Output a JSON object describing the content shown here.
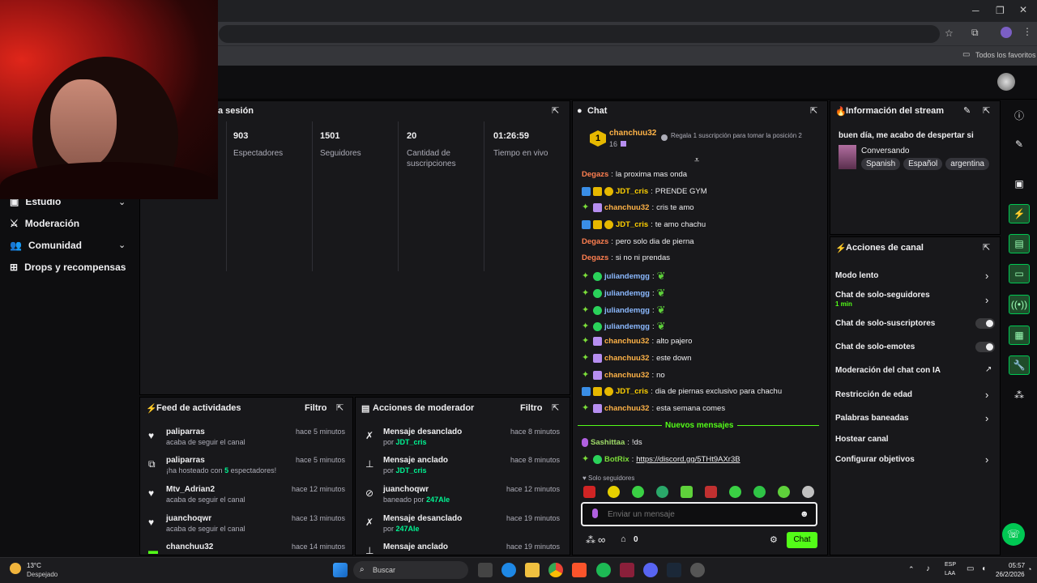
{
  "browser": {
    "bookmarks_label": "Todos los favoritos"
  },
  "nav": {
    "items": [
      {
        "label": "Estudio"
      },
      {
        "label": "Moderación"
      },
      {
        "label": "Comunidad"
      },
      {
        "label": "Drops y recompensas"
      }
    ]
  },
  "session": {
    "title_fragment": "a sesión",
    "stats": [
      {
        "value": "903",
        "label": "Espectadores"
      },
      {
        "value": "1501",
        "label": "Seguidores"
      },
      {
        "value": "20",
        "label": "Cantidad de suscripciones"
      },
      {
        "value": "01:26:59",
        "label": "Tiempo en vivo"
      }
    ]
  },
  "feed": {
    "title": "Feed de actividades",
    "filter": "Filtro",
    "items": [
      {
        "name": "paliparras",
        "sub": "acaba de seguir el canal",
        "time": "hace 5 minutos"
      },
      {
        "name": "paliparras",
        "sub_pre": "¡ha hosteado con ",
        "sub_num": "5",
        "sub_post": " espectadores!",
        "time": "hace 5 minutos"
      },
      {
        "name": "Mtv_Adrian2",
        "sub": "acaba de seguir el canal",
        "time": "hace 12 minutos"
      },
      {
        "name": "juanchoqwr",
        "sub": "acaba de seguir el canal",
        "time": "hace 13 minutos"
      },
      {
        "name": "chanchuu32",
        "time": "hace 14 minutos"
      }
    ]
  },
  "modactions": {
    "title": "Acciones de moderador",
    "filter": "Filtro",
    "items": [
      {
        "title": "Mensaje desanclado",
        "by": "por",
        "user": "JDT_cris",
        "time": "hace 8 minutos"
      },
      {
        "title": "Mensaje anclado",
        "by": "por",
        "user": "JDT_cris",
        "time": "hace 8 minutos"
      },
      {
        "title": "juanchoqwr",
        "by": "baneado por",
        "user": "247Ale",
        "time": "hace 12 minutos"
      },
      {
        "title": "Mensaje desanclado",
        "by": "por",
        "user": "247Ale",
        "time": "hace 19 minutos"
      },
      {
        "title": "Mensaje anclado",
        "time": "hace 19 minutos"
      }
    ]
  },
  "chat": {
    "title": "Chat",
    "pinned": {
      "user": "chanchuu32",
      "count": "16",
      "text": "Regala 1 suscripción para tomar la posición 2",
      "rank": "1"
    },
    "messages": [
      {
        "user": "Degazs",
        "text": "la proxima mas onda"
      },
      {
        "user": "JDT_cris",
        "text": "PRENDE GYM"
      },
      {
        "user": "chanchuu32",
        "text": "cris te amo"
      },
      {
        "user": "JDT_cris",
        "text": "te amo chachu"
      },
      {
        "user": "Degazs",
        "text": "pero solo dia de pierna"
      },
      {
        "user": "Degazs",
        "text": "si no ni prendas"
      },
      {
        "user": "juliandemgg",
        "text": ""
      },
      {
        "user": "juliandemgg",
        "text": ""
      },
      {
        "user": "juliandemgg",
        "text": ""
      },
      {
        "user": "juliandemgg",
        "text": ""
      },
      {
        "user": "chanchuu32",
        "text": "alto pajero"
      },
      {
        "user": "chanchuu32",
        "text": "este down"
      },
      {
        "user": "chanchuu32",
        "text": "no"
      },
      {
        "user": "JDT_cris",
        "text": "dia de piernas exclusivo para chachu"
      },
      {
        "user": "chanchuu32",
        "text": "esta semana comes"
      }
    ],
    "new_messages": "Nuevos mensajes",
    "after": [
      {
        "user": "Sashittaa",
        "text": "!ds"
      },
      {
        "user": "BotRix",
        "text": "https://discord.gg/5THt9AXr3B"
      }
    ],
    "followers_only": "Solo seguidores",
    "input_placeholder": "Enviar un mensaje",
    "points": "0",
    "send_label": "Chat"
  },
  "streaminfo": {
    "title": "Información del stream",
    "stream_title": "buen día, me acabo de despertar si",
    "category": "Conversando",
    "tags": [
      "Spanish",
      "Español",
      "argentina"
    ]
  },
  "channel_actions": {
    "title": "Acciones de canal",
    "items": [
      {
        "label": "Modo lento"
      },
      {
        "label": "Chat de solo-seguidores",
        "sub": "1 min"
      },
      {
        "label": "Chat de solo-suscriptores"
      },
      {
        "label": "Chat de solo-emotes"
      },
      {
        "label": "Moderación del chat con IA"
      },
      {
        "label": "Restricción de edad"
      },
      {
        "label": "Palabras baneadas"
      },
      {
        "label": "Hostear canal"
      },
      {
        "label": "Configurar objetivos"
      }
    ]
  },
  "taskbar": {
    "weather_temp": "13°C",
    "weather_desc": "Despejado",
    "search": "Buscar",
    "lang1": "ESP",
    "lang2": "LAA",
    "time": "05:57",
    "date": "26/2/2026"
  },
  "colors": {
    "accent": "#53fc18",
    "panel": "#18181b",
    "bg": "#0e0e10"
  }
}
